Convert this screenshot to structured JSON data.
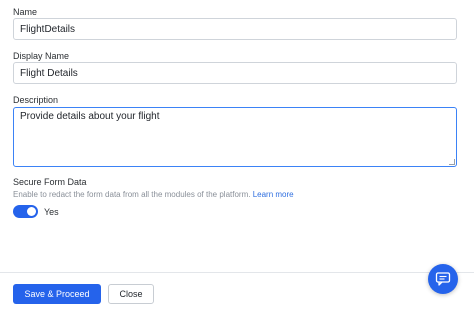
{
  "form": {
    "name": {
      "label": "Name",
      "value": "FlightDetails"
    },
    "display_name": {
      "label": "Display Name",
      "value": "Flight Details"
    },
    "description": {
      "label": "Description",
      "value": "Provide details about your flight"
    }
  },
  "secure": {
    "title": "Secure Form Data",
    "help_text": "Enable to redact the form data from all the modules of the platform.",
    "learn_more": "Learn more",
    "toggle_on": true,
    "toggle_label": "Yes"
  },
  "footer": {
    "primary_label": "Save & Proceed",
    "secondary_label": "Close"
  },
  "icons": {
    "chat": "chat-bubble-icon",
    "accent_color": "#2563eb"
  }
}
